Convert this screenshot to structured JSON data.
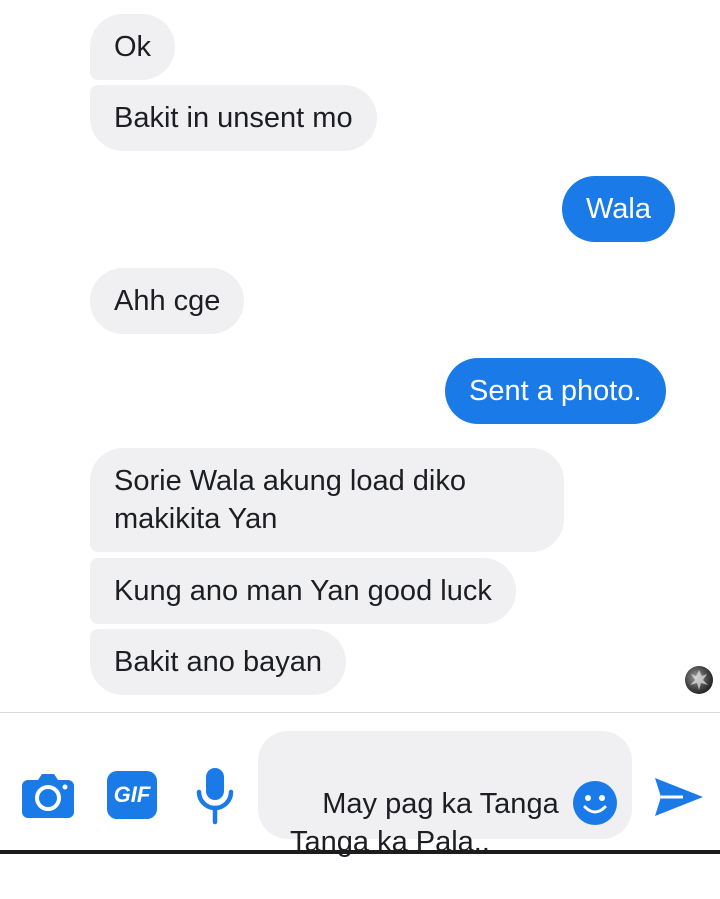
{
  "messages": [
    {
      "side": "in",
      "text": "Ok"
    },
    {
      "side": "in",
      "text": "Bakit in unsent mo"
    },
    {
      "side": "out",
      "text": "Wala"
    },
    {
      "side": "in",
      "text": "Ahh cge"
    },
    {
      "side": "out",
      "text": "Sent a photo."
    },
    {
      "side": "in",
      "text": "Sorie Wala akung load diko makikita Yan"
    },
    {
      "side": "in",
      "text": "Kung ano man Yan good luck"
    },
    {
      "side": "in",
      "text": "Bakit ano bayan"
    }
  ],
  "composer": {
    "draft_text": "May pag ka Tanga\nTanga ka Pala..",
    "gif_label": "GIF"
  },
  "colors": {
    "accent": "#1a7ae8",
    "incoming_bubble": "#f0f0f2",
    "text": "#1c1e21"
  },
  "icons": {
    "camera": "camera-icon",
    "gif": "gif-icon",
    "mic": "microphone-icon",
    "emoji": "emoji-icon",
    "send": "send-icon",
    "seen": "seen-avatar"
  }
}
